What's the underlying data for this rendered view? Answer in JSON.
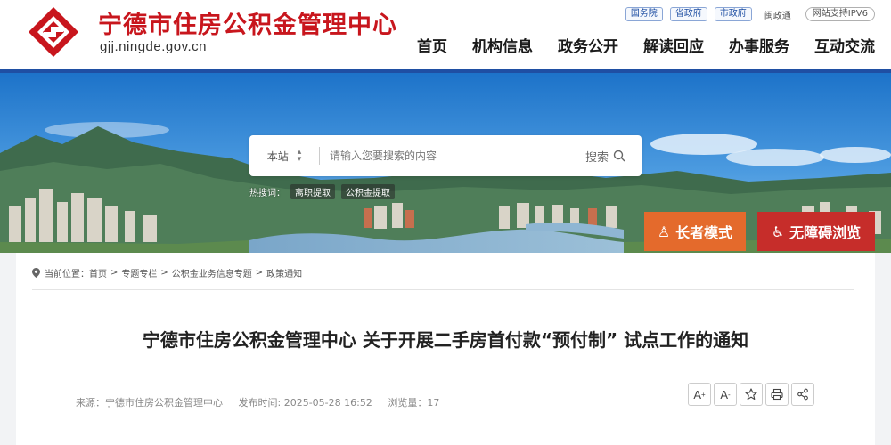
{
  "header": {
    "site_name": "宁德市住房公积金管理中心",
    "site_domain": "gjj.ningde.gov.cn",
    "top_links": [
      "国务院",
      "省政府",
      "市政府"
    ],
    "top_plain": "闽政通",
    "ipv6_badge": "网站支持IPV6",
    "nav": [
      "首页",
      "机构信息",
      "政务公开",
      "解读回应",
      "办事服务",
      "互动交流"
    ]
  },
  "search": {
    "scope": "本站",
    "placeholder": "请输入您要搜索的内容",
    "button_label": "搜索",
    "hot_label": "热搜词：",
    "hot_words": [
      "离职提取",
      "公积金提取"
    ]
  },
  "modes": {
    "elder": "长者模式",
    "accessible": "无障碍浏览"
  },
  "breadcrumb": {
    "label": "当前位置：",
    "items": [
      "首页",
      "专题专栏",
      "公积金业务信息专题",
      "政策通知"
    ]
  },
  "article": {
    "title": "宁德市住房公积金管理中心 关于开展二手房首付款“预付制” 试点工作的通知",
    "source": "来源：宁德市住房公积金管理中心",
    "published": "发布时间: 2025-05-28 16:52",
    "views": "浏览量：17"
  },
  "tools": {
    "font_up": "A",
    "font_down": "A"
  },
  "colors": {
    "brand_red": "#c8161d",
    "nav_blue": "#1f4fa3",
    "elder_orange": "#e46a2c",
    "access_red": "#c62d2a"
  }
}
